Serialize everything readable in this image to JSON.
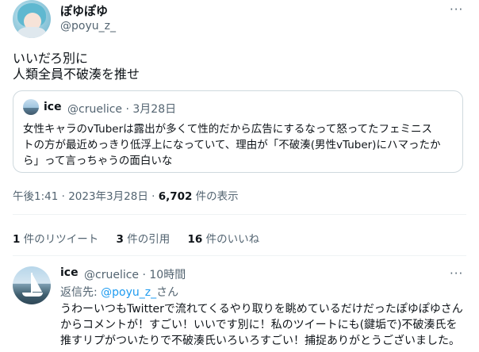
{
  "main": {
    "display_name": "ぽゆぽゆ",
    "handle": "@poyu_z_",
    "more": "···",
    "text_lines": [
      "いいだろ別に",
      "人類全員不破湊を推せ"
    ],
    "quote": {
      "name": "ice",
      "handle_time": "@cruelice · 3月28日",
      "text_lines": [
        "女性キャラのvTuberは露出が多くて性的だから広告にするなって怒ってたフェミニス",
        "トの方が最近めっきり低浮上になっていて、理由が「不破湊(男性vTuber)にハマったか",
        "ら」って言っちゃうの面白いな"
      ]
    },
    "meta": {
      "datetime": "午後1:41 · 2023年3月28日 · ",
      "views_count": "6,702",
      "views_label": " 件の表示"
    },
    "stats": {
      "retweets_count": "1",
      "retweets_label": " 件のリツイート",
      "quotes_count": "3",
      "quotes_label": " 件の引用",
      "likes_count": "16",
      "likes_label": " 件のいいね"
    }
  },
  "reply": {
    "name": "ice",
    "handle_time": "@cruelice · 10時間",
    "more": "···",
    "replying_prefix": "返信先: ",
    "replying_handle": "@poyu_z_",
    "replying_suffix": "さん",
    "text_lines": [
      "うわーいつもTwitterで流れてくるやり取りを眺めているだけだったぽゆぽゆさん",
      "からコメントが！すごい！いいです別に！私のツイートにも(鍵垢で)不破湊氏を",
      "推すリプがついたりで不破湊氏いろいろすごい！捕捉ありがとうございました。"
    ]
  }
}
